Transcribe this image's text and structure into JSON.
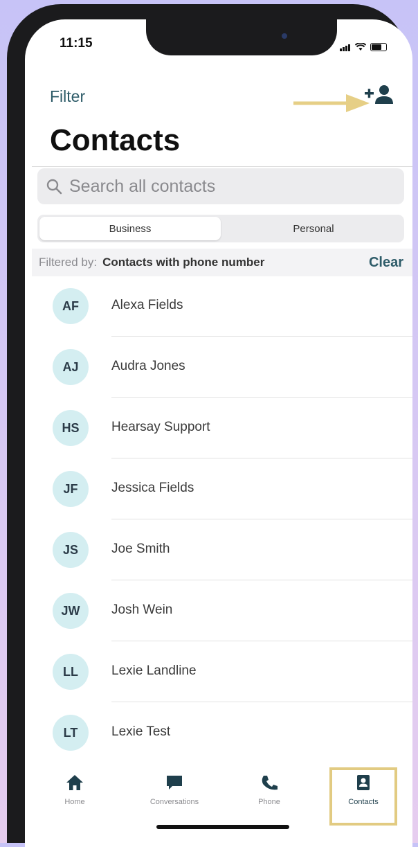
{
  "status_bar": {
    "time": "11:15"
  },
  "header": {
    "filter_label": "Filter",
    "title": "Contacts",
    "add_contact_icon": "add-person-icon",
    "annotation_arrow_color": "#e6cf86"
  },
  "search": {
    "placeholder": "Search all contacts"
  },
  "segments": {
    "business": "Business",
    "personal": "Personal",
    "selected": "Business"
  },
  "filter_bar": {
    "label": "Filtered by:",
    "value": "Contacts with phone number",
    "clear_label": "Clear"
  },
  "contacts": [
    {
      "initials": "AF",
      "name": "Alexa Fields"
    },
    {
      "initials": "AJ",
      "name": "Audra Jones"
    },
    {
      "initials": "HS",
      "name": "Hearsay Support"
    },
    {
      "initials": "JF",
      "name": "Jessica Fields"
    },
    {
      "initials": "JS",
      "name": "Joe Smith"
    },
    {
      "initials": "JW",
      "name": "Josh Wein"
    },
    {
      "initials": "LL",
      "name": "Lexie Landline"
    },
    {
      "initials": "LT",
      "name": "Lexie Test"
    }
  ],
  "tab_bar": {
    "home": "Home",
    "conversations": "Conversations",
    "phone": "Phone",
    "contacts": "Contacts",
    "active": "Contacts",
    "highlight_color": "#e2cb82"
  },
  "colors": {
    "accent": "#2d5b68",
    "avatar_bg": "#d4eef1",
    "icon_dark": "#1f3f4c"
  }
}
